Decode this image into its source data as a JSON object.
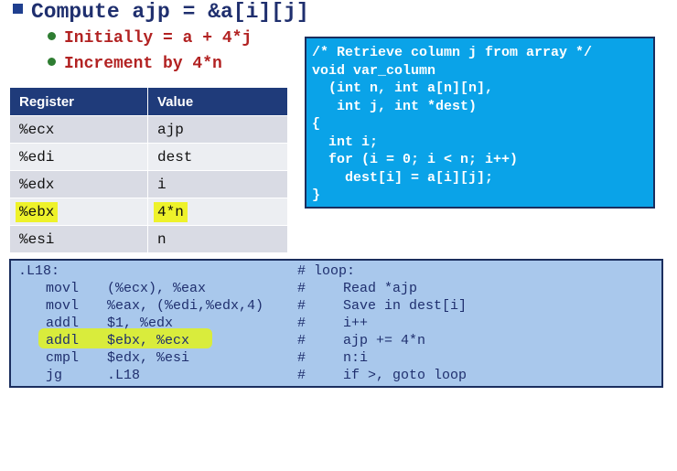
{
  "heading": "Compute ajp = &a[i][j]",
  "bullets": [
    "Initially = a + 4*j",
    "Increment by 4*n"
  ],
  "table": {
    "headers": [
      "Register",
      "Value"
    ],
    "rows": [
      {
        "reg": "%ecx",
        "value": "ajp"
      },
      {
        "reg": "%edi",
        "value": "dest"
      },
      {
        "reg": "%edx",
        "value": "i"
      },
      {
        "reg": "%ebx",
        "value": "4*n"
      },
      {
        "reg": "%esi",
        "value": "n"
      }
    ],
    "highlight_row": 3
  },
  "c_code": [
    "/* Retrieve column j from array */",
    "void var_column",
    "  (int n, int a[n][n],",
    "   int j, int *dest)",
    "{",
    "  int i;",
    "  for (i = 0; i < n; i++)",
    "    dest[i] = a[i][j];",
    "}"
  ],
  "asm": {
    "label": ".L18:",
    "label_comment": "# loop:",
    "lines": [
      {
        "op": "movl",
        "args": "(%ecx), %eax",
        "hash": "#",
        "comment": "Read *ajp"
      },
      {
        "op": "movl",
        "args": "%eax, (%edi,%edx,4)",
        "hash": "#",
        "comment": "Save in dest[i]"
      },
      {
        "op": "addl",
        "args": "$1, %edx",
        "hash": "#",
        "comment": "i++"
      },
      {
        "op": "addl",
        "args": "$ebx, %ecx",
        "hash": "#",
        "comment": "ajp += 4*n"
      },
      {
        "op": "cmpl",
        "args": "$edx, %esi",
        "hash": "#",
        "comment": "n:i"
      },
      {
        "op": "jg",
        "args": ".L18",
        "hash": "#",
        "comment": "if >, goto loop"
      }
    ],
    "highlight_line": 3
  },
  "colors": {
    "header_bg": "#1f3b7a",
    "code_box_bg": "#0aa3e8",
    "asm_box_bg": "#a9c8ec",
    "highlight": "#eef22a",
    "bullet_text": "#b22222"
  }
}
